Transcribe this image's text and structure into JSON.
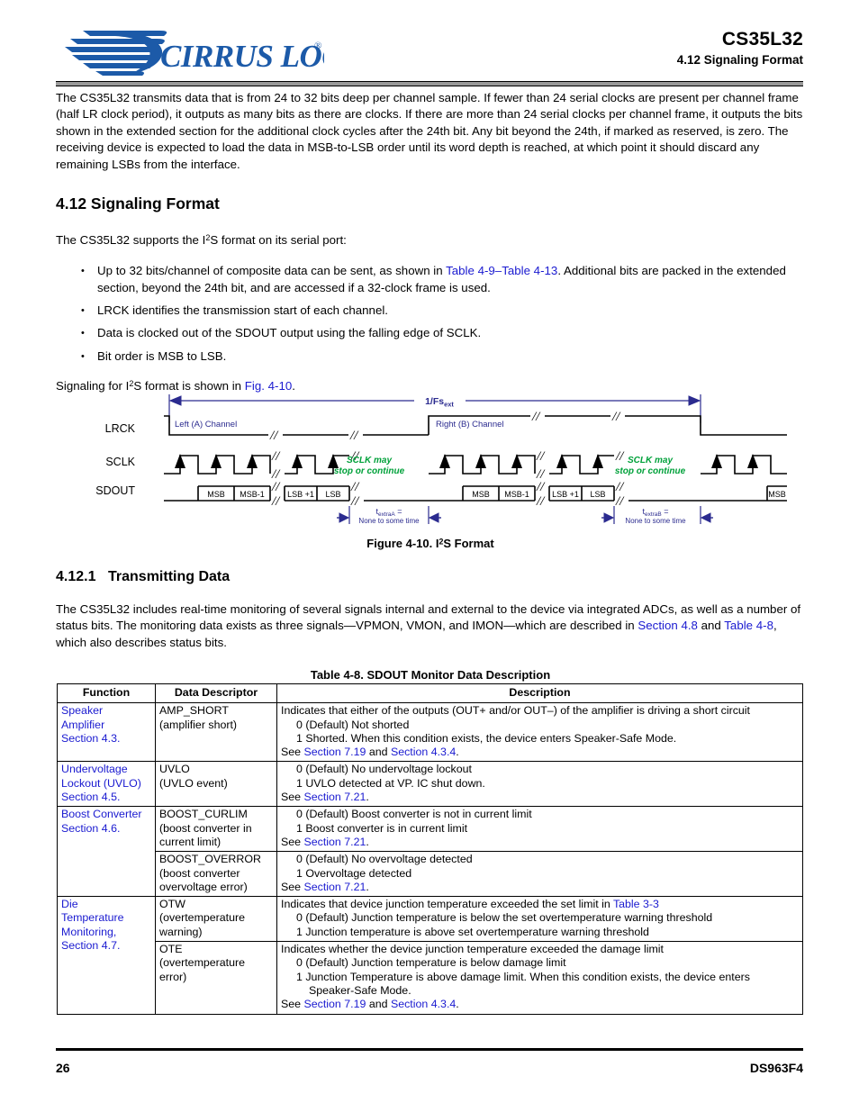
{
  "header": {
    "logo_text": "CIRRUS LOGIC",
    "logo_mark": "cirrus-swoosh",
    "registered": "®",
    "part_number": "CS35L32",
    "section_ref": "4.12 Signaling Format"
  },
  "intro_paragraph": "The CS35L32 transmits data that is from 24 to 32 bits deep per channel sample. If fewer than 24 serial clocks are present per channel frame (half LR clock period), it outputs as many bits as there are clocks. If there are more than 24 serial clocks per channel frame, it outputs the bits shown in the extended section for the additional clock cycles after the 24th bit. Any bit beyond the 24th, if marked as reserved, is zero. The receiving device is expected to load the data in MSB-to-LSB order until its word depth is reached, at which point it should discard any remaining LSBs from the interface.",
  "section_412": {
    "heading": "4.12 Signaling Format",
    "lead_prefix": "The CS35L32 supports the I",
    "lead_sup": "2",
    "lead_suffix": "S format on its serial port:",
    "bullets": [
      {
        "pre": "Up to 32 bits/channel of composite data can be sent, as shown in ",
        "link1": "Table 4-9",
        "dash": "–",
        "link2": "Table 4-13",
        "post": ". Additional bits are packed in the extended section, beyond the 24th bit, and are accessed if a 32-clock frame is used."
      },
      {
        "pre": "LRCK identifies the transmission start of each channel."
      },
      {
        "pre": "Data is clocked out of the SDOUT output using the falling edge of SCLK."
      },
      {
        "pre": "Bit order is MSB to LSB."
      }
    ],
    "fig_lead_prefix": "Signaling for I",
    "fig_lead_sup": "2",
    "fig_lead_mid": "S format is shown in ",
    "fig_lead_link": "Fig. 4-10",
    "fig_lead_post": "."
  },
  "figure": {
    "caption_prefix": "Figure 4-10. I",
    "caption_sup": "2",
    "caption_suffix": "S Format",
    "period_label_prefix": "1/Fs",
    "period_label_sub": "ext",
    "signals": [
      "LRCK",
      "SCLK",
      "SDOUT"
    ],
    "left_channel_label": "Left (A) Channel",
    "right_channel_label": "Right (B) Channel",
    "sclk_note_line1": "SCLK may",
    "sclk_note_line2": "stop or continue",
    "data_cells_left": [
      "MSB",
      "MSB-1",
      "LSB +1",
      "LSB"
    ],
    "data_cells_right": [
      "MSB",
      "MSB-1",
      "LSB +1",
      "LSB"
    ],
    "trailing_cell": "MSB",
    "extra_a": {
      "prefix": "t",
      "sub": "extraA",
      "eq": " =",
      "line2": "None to some time"
    },
    "extra_b": {
      "prefix": "t",
      "sub": "extraB",
      "eq": " =",
      "line2": "None to some time"
    },
    "colors": {
      "annotation": "#2b2b8f",
      "note": "#00a13a",
      "wave": "#000000"
    }
  },
  "section_4121": {
    "number": "4.12.1",
    "heading": "Transmitting Data",
    "paragraph_pre": "The CS35L32 includes real-time monitoring of several signals internal and external to the device via integrated ADCs, as well as a number of status bits. The monitoring data exists as three signals—VPMON, VMON, and IMON—which are described in ",
    "link1": "Section 4.8",
    "mid": " and ",
    "link2": "Table 4-8",
    "post": ", which also describes status bits."
  },
  "table": {
    "title": "Table 4-8.  SDOUT Monitor Data Description",
    "columns": [
      "Function",
      "Data Descriptor",
      "Description"
    ],
    "rows": [
      {
        "function_lines": [
          "Speaker",
          "Amplifier",
          "Section 4.3."
        ],
        "function_link": true,
        "function_rowspan": 1,
        "descriptor_lines": [
          "AMP_SHORT",
          "(amplifier short)"
        ],
        "description": {
          "lead": "Indicates that either of the outputs (OUT+ and/or OUT–) of the amplifier is driving a short circuit",
          "options": [
            "0 (Default) Not shorted",
            "1 Shorted. When this condition exists, the device enters Speaker-Safe Mode."
          ],
          "see_pre": "See ",
          "see_link1": "Section 7.19",
          "see_mid": " and ",
          "see_link2": "Section 4.3.4",
          "see_post": "."
        }
      },
      {
        "function_lines": [
          "Undervoltage",
          "Lockout (UVLO)",
          "Section 4.5."
        ],
        "function_link": true,
        "function_rowspan": 1,
        "descriptor_lines": [
          "UVLO",
          "(UVLO event)"
        ],
        "description": {
          "lead": "",
          "options": [
            "0 (Default) No undervoltage lockout",
            "1 UVLO detected at VP. IC shut down."
          ],
          "see_pre": "See ",
          "see_link1": "Section 7.21",
          "see_post": "."
        }
      },
      {
        "function_lines": [
          "Boost Converter",
          "Section 4.6."
        ],
        "function_link": true,
        "function_rowspan": 2,
        "descriptor_lines": [
          "BOOST_CURLIM",
          "(boost converter in",
          "current limit)"
        ],
        "description": {
          "lead": "",
          "options": [
            "0 (Default) Boost converter is not in current limit",
            "1  Boost converter is in current limit"
          ],
          "see_pre": "See ",
          "see_link1": "Section 7.21",
          "see_post": "."
        }
      },
      {
        "function_lines": [],
        "function_link": true,
        "function_rowspan": 0,
        "descriptor_lines": [
          "BOOST_OVERROR",
          "(boost converter",
          "overvoltage error)"
        ],
        "description": {
          "lead": "",
          "options": [
            "0 (Default) No overvoltage detected",
            "1 Overvoltage detected"
          ],
          "see_pre": "See ",
          "see_link1": "Section 7.21",
          "see_post": "."
        }
      },
      {
        "function_lines": [
          "Die",
          "Temperature",
          "Monitoring,",
          "Section 4.7."
        ],
        "function_link": true,
        "function_rowspan": 2,
        "descriptor_lines": [
          "OTW",
          "(overtemperature",
          "warning)"
        ],
        "description": {
          "lead_pre": "Indicates that device junction temperature exceeded the set limit in ",
          "lead_link": "Table 3-3",
          "lead": "",
          "options": [
            "0 (Default) Junction temperature is below the set overtemperature warning threshold",
            "1 Junction temperature is above set overtemperature warning threshold"
          ]
        }
      },
      {
        "function_lines": [],
        "function_link": true,
        "function_rowspan": 0,
        "descriptor_lines": [
          "OTE",
          "(overtemperature",
          "error)"
        ],
        "description": {
          "lead": "Indicates whether the device junction temperature exceeded the damage limit",
          "options": [
            "0 (Default) Junction temperature is below damage limit",
            "1  Junction Temperature is above damage limit. When this condition exists, the device enters"
          ],
          "option_cont": "Speaker-Safe Mode.",
          "see_pre": "See ",
          "see_link1": "Section 7.19",
          "see_mid": " and ",
          "see_link2": "Section 4.3.4",
          "see_post": "."
        }
      }
    ]
  },
  "footer": {
    "page_number": "26",
    "doc_id": "DS963F4"
  }
}
